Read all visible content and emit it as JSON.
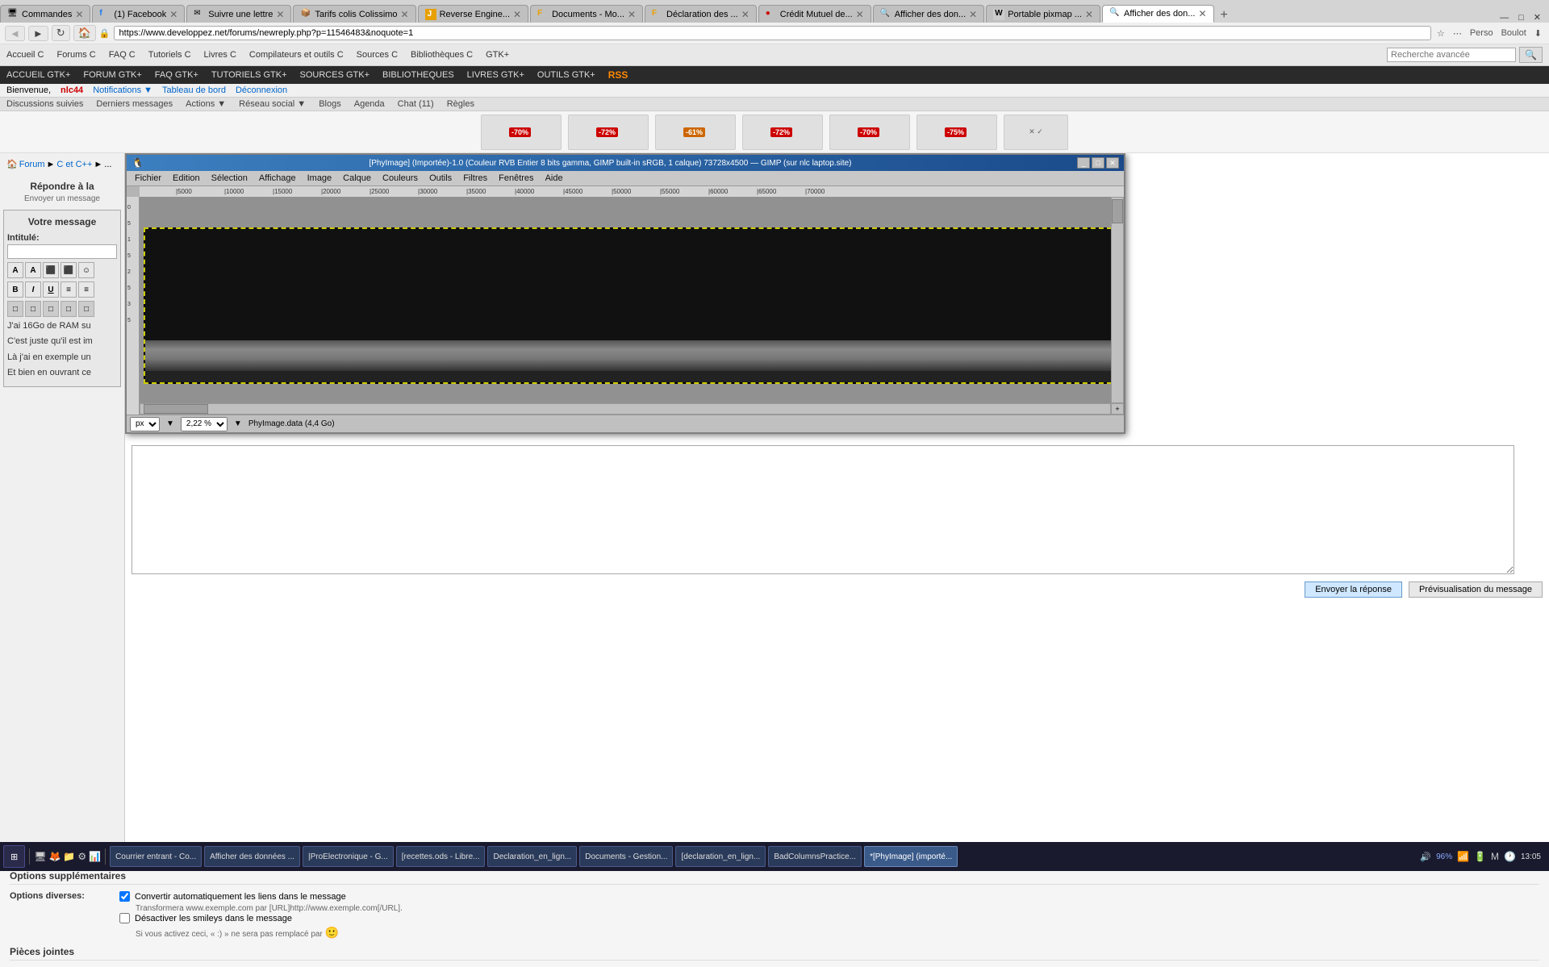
{
  "browser": {
    "tabs": [
      {
        "label": "Commandes",
        "favicon": "🖥",
        "active": false
      },
      {
        "label": "(1) Facebook",
        "favicon": "f",
        "active": false
      },
      {
        "label": "Suivre une lettre",
        "favicon": "✉",
        "active": false
      },
      {
        "label": "Tarifs colis Colissimo",
        "favicon": "📦",
        "active": false
      },
      {
        "label": "Reverse Engine...",
        "favicon": "J",
        "active": false
      },
      {
        "label": "Documents - Mo...",
        "favicon": "F",
        "active": false
      },
      {
        "label": "Déclaration des ...",
        "favicon": "F",
        "active": false
      },
      {
        "label": "Crédit Mutuel de...",
        "favicon": "🔴",
        "active": false
      },
      {
        "label": "Afficher des don...",
        "favicon": "🔍",
        "active": false
      },
      {
        "label": "Portable pixmap ...",
        "favicon": "W",
        "active": false
      },
      {
        "label": "Afficher des don...",
        "favicon": "🔍",
        "active": true
      }
    ],
    "url": "https://www.developpez.net/forums/newreply.php?p=11546483&noquote=1",
    "nav_back": "◄",
    "nav_forward": "►",
    "nav_reload": "↻",
    "nav_home": "🏠"
  },
  "site": {
    "top_nav_items": [
      "Accueil C",
      "Forums C",
      "FAQ C",
      "Tutoriels C",
      "Livres C",
      "Compilateurs et outils C",
      "Sources C",
      "Bibliothèques C",
      "GTK+"
    ],
    "gtk_nav_items": [
      "ACCUEIL GTK+",
      "FORUM GTK+",
      "FAQ GTK+",
      "TUTORIELS GTK+",
      "SOURCES GTK+",
      "BIBLIOTHEQUES",
      "LIVRES GTK+",
      "OUTILS GTK+"
    ],
    "sub_nav_items": [
      "Discussions suivies",
      "Derniers messages",
      "Actions ▼",
      "Réseau social ▼",
      "Blogs",
      "Agenda",
      "Chat (11)",
      "Règles"
    ],
    "user_greeting": "Bienvenue,",
    "username": "nlc44",
    "user_links": [
      "Notifications ▼",
      "Tableau de bord",
      "Déconnexion"
    ],
    "search_placeholder": "Recherche avancée"
  },
  "gimp": {
    "title": "[PhyImage] (Importée)-1.0 (Couleur RVB Entier 8 bits gamma, GIMP built-in sRGB, 1 calque) 73728x4500 — GIMP (sur nlc laptop.site)",
    "menu_items": [
      "Fichier",
      "Edition",
      "Sélection",
      "Affichage",
      "Image",
      "Calque",
      "Couleurs",
      "Outils",
      "Filtres",
      "Fenêtres",
      "Aide"
    ],
    "ruler_marks": [
      "|5000",
      "|10000",
      "|15000",
      "|20000",
      "|25000",
      "|30000",
      "|35000",
      "|40000",
      "|45000",
      "|50000",
      "|55000",
      "|60000",
      "|65000",
      "|70000"
    ],
    "ruler_v_marks": [
      "0",
      "5",
      "1",
      "5",
      "2",
      "5",
      "3",
      "5"
    ],
    "unit": "px",
    "zoom": "2,22 %",
    "file_info": "PhyImage.data (4,4 Go)"
  },
  "forum": {
    "breadcrumb": [
      "Forum",
      "C et C++",
      "..."
    ],
    "reply_title": "Répondre à la",
    "reply_subtitle": "Envoyer un message",
    "your_message": "Votre message",
    "intitule_label": "Intitulé:",
    "toolbar_buttons": [
      "A",
      "A",
      "⬛",
      "⬛",
      "☺"
    ],
    "format_bold": "B",
    "format_italic": "I",
    "format_underline": "U",
    "align_left": "≡",
    "align_right": "≡",
    "message_content_lines": [
      "J'ai 16Go de RAM su",
      "C'est juste qu'il est im",
      "Là j'ai en exemple un",
      "Et bien en ouvrant ce"
    ]
  },
  "reply_buttons": {
    "send": "Envoyer la réponse",
    "preview": "Prévisualisation du message"
  },
  "options": {
    "section_title": "Options supplémentaires",
    "diverses_label": "Options diverses:",
    "option1_checked": true,
    "option1_label": "Convertir automatiquement les liens dans le message",
    "option1_note": "Transformera www.exemple.com par [URL]http://www.exemple.com[/URL].",
    "option2_checked": false,
    "option2_label": "Désactiver les smileys dans le message",
    "option2_note": "Si vous activez ceci, « :) » ne sera pas remplacé par",
    "pieces_title": "Pièces jointes"
  },
  "taskbar": {
    "start_label": "⊞",
    "items": [
      {
        "label": "Courrier entrant - Co...",
        "active": false
      },
      {
        "label": "Afficher des données ...",
        "active": false
      },
      {
        "label": "|ProElectronique - G...",
        "active": false
      },
      {
        "label": "[recettes.ods - Libre...",
        "active": false
      },
      {
        "label": "Declaration_en_lign...",
        "active": false
      },
      {
        "label": "Documents - Gestion...",
        "active": false
      },
      {
        "label": "[declaration_en_lign...",
        "active": false
      },
      {
        "label": "BadColumnsPractice...",
        "active": false
      },
      {
        "label": "*[PhyImage] (importé...",
        "active": true
      }
    ],
    "time": "13:05",
    "volume_pct": "96%",
    "battery": "🔋"
  },
  "ads": [
    {
      "badge": "-70%",
      "color": "#cc0000"
    },
    {
      "badge": "-72%",
      "color": "#cc0000"
    },
    {
      "badge": "-61%",
      "color": "#cc6600"
    },
    {
      "badge": "-72%",
      "color": "#cc0000"
    },
    {
      "badge": "-70%",
      "color": "#cc0000"
    },
    {
      "badge": "-75%",
      "color": "#cc0000"
    }
  ]
}
